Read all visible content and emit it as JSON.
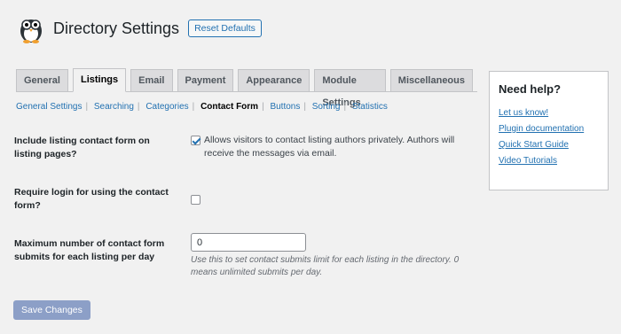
{
  "header": {
    "title": "Directory Settings",
    "reset_label": "Reset Defaults",
    "logo_icon": "penguin-logo-icon"
  },
  "tabs": [
    {
      "label": "General"
    },
    {
      "label": "Listings",
      "active": true
    },
    {
      "label": "Email"
    },
    {
      "label": "Payment"
    },
    {
      "label": "Appearance"
    },
    {
      "label": "Module Settings"
    },
    {
      "label": "Miscellaneous"
    }
  ],
  "subnav": [
    {
      "label": "General Settings"
    },
    {
      "label": "Searching"
    },
    {
      "label": "Categories"
    },
    {
      "label": "Contact Form",
      "current": true
    },
    {
      "label": "Buttons"
    },
    {
      "label": "Sorting"
    },
    {
      "label": "Statistics"
    }
  ],
  "settings": {
    "contact_form": {
      "label": "Include listing contact form on listing pages?",
      "checked": true,
      "text": "Allows visitors to contact listing authors privately. Authors will receive the messages via email."
    },
    "require_login": {
      "label": "Require login for using the contact form?",
      "checked": false
    },
    "max_submits": {
      "label": "Maximum number of contact form submits for each listing per day",
      "value": "0",
      "description": "Use this to set contact submits limit for each listing in the directory. 0 means unlimited submits per day."
    }
  },
  "save_label": "Save Changes",
  "help": {
    "title": "Need help?",
    "links": [
      "Let us know!",
      "Plugin documentation",
      "Quick Start Guide",
      "Video Tutorials"
    ]
  },
  "colors": {
    "accent": "#2271b1",
    "save_button": "#8c9fc7",
    "background": "#f1f1f1"
  }
}
